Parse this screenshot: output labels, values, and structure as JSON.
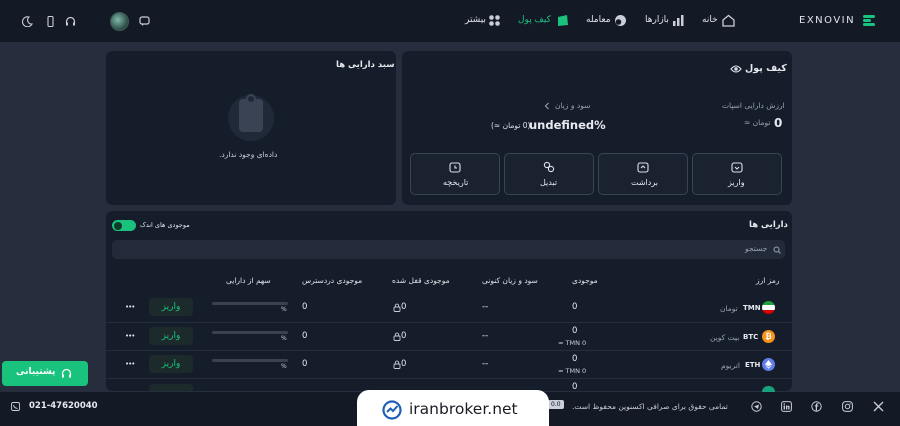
{
  "brand": {
    "name": "EXNOVIN",
    "accent": "#19c37d"
  },
  "nav": {
    "home": "خانه",
    "markets": "بازارها",
    "trade": "معامله",
    "wallet": "کیف پول",
    "more": "بیشتر"
  },
  "wallet": {
    "title": "کیف پول",
    "asset_value_label": "ارزش دارایی اسپات",
    "asset_value": "0",
    "asset_unit": "تومان ≈",
    "pnl_label": "سود و زیان",
    "pnl_value": "undefined%",
    "pnl_sub": "(0 تومان ≈)",
    "actions": [
      "واریز",
      "برداشت",
      "تبدیل",
      "تاریخچه"
    ]
  },
  "basket": {
    "title": "سبد دارایی ها",
    "empty": "داده‌ای وجود ندارد."
  },
  "assets": {
    "title": "دارایی ها",
    "small_toggle_label": "موجودی های اندک",
    "search_placeholder": "جستجو",
    "headers": [
      "رمز ارز",
      "موجودی",
      "سود و زیان کنونی",
      "موجودی قفل شده",
      "موجودی دردسترس",
      "سهم از دارایی"
    ],
    "rows": [
      {
        "symbol": "TMN",
        "name": "تومان",
        "balance": "0",
        "balance_sub": "",
        "pnl": "--",
        "locked": "0",
        "available": "0",
        "share": "%",
        "deposit": "واریز",
        "more": "•••"
      },
      {
        "symbol": "BTC",
        "name": "بیت کوین",
        "balance": "0",
        "balance_sub": "0 TMN ≈",
        "pnl": "--",
        "locked": "0",
        "available": "0",
        "share": "%",
        "deposit": "واریز",
        "more": "•••"
      },
      {
        "symbol": "ETH",
        "name": "اتریوم",
        "balance": "0",
        "balance_sub": "0 TMN ≈",
        "pnl": "--",
        "locked": "0",
        "available": "0",
        "share": "%",
        "deposit": "واریز",
        "more": "•••"
      },
      {
        "symbol": "",
        "name": "",
        "balance": "0",
        "balance_sub": "",
        "pnl": "",
        "locked": "",
        "available": "",
        "share": "",
        "deposit": "",
        "more": ""
      }
    ]
  },
  "support": {
    "label": "پشتیبانی"
  },
  "footer": {
    "phone": "021-47620040",
    "copyright": "تمامی حقوق برای صرافی اکسنوین محفوظ است.",
    "version": "0.0"
  },
  "watermark": {
    "text": "iranbroker.net"
  }
}
